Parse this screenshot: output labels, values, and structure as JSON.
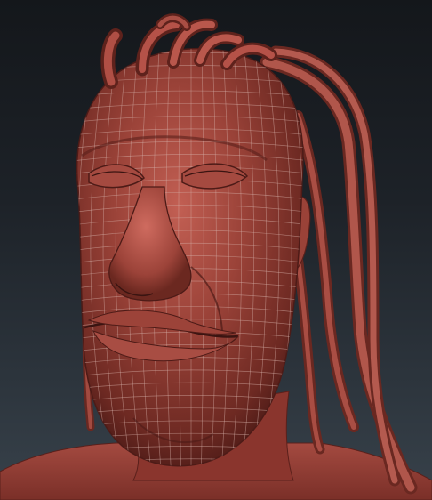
{
  "scene": {
    "subject": "sculpted-head-wireframe",
    "colors": {
      "skin_base": "#8e3b33",
      "skin_light": "#b9574c",
      "skin_dark": "#5a201b",
      "wire": "#d7b3ad",
      "background_top": "#14171b",
      "background_bottom": "#38424b"
    }
  }
}
